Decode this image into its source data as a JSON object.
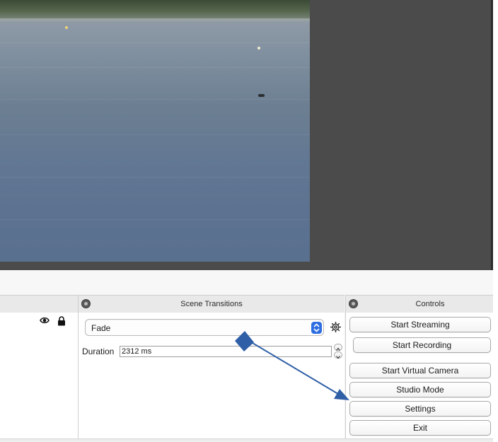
{
  "docks": {
    "transitions": {
      "title": "Scene Transitions",
      "selected_transition": "Fade",
      "duration_label": "Duration",
      "duration_value": "2312 ms"
    },
    "controls": {
      "title": "Controls",
      "buttons": [
        "Start Streaming",
        "Start Recording",
        "Start Virtual Camera",
        "Studio Mode",
        "Settings",
        "Exit"
      ]
    }
  },
  "icons": {
    "sources": [
      "eye-icon",
      "lock-icon"
    ],
    "transitions": [
      "chevron-updown-icon",
      "gear-icon"
    ],
    "docks": [
      "float-dock-icon"
    ]
  },
  "colors": {
    "select_accent": "#2f6ee0",
    "annotation_arrow": "#2f5fa6"
  }
}
